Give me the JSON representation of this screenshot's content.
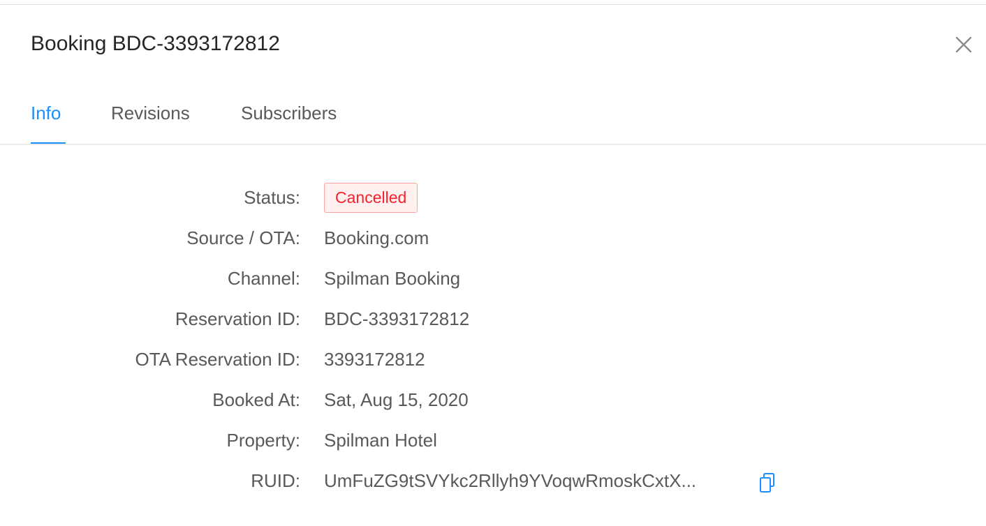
{
  "header": {
    "title": "Booking BDC-3393172812"
  },
  "tabs": [
    {
      "label": "Info",
      "active": true
    },
    {
      "label": "Revisions",
      "active": false
    },
    {
      "label": "Subscribers",
      "active": false
    }
  ],
  "info": {
    "status_label": "Status:",
    "status_value": "Cancelled",
    "source_label": "Source / OTA:",
    "source_value": "Booking.com",
    "channel_label": "Channel:",
    "channel_value": "Spilman Booking",
    "reservation_id_label": "Reservation ID:",
    "reservation_id_value": "BDC-3393172812",
    "ota_reservation_id_label": "OTA Reservation ID:",
    "ota_reservation_id_value": "3393172812",
    "booked_at_label": "Booked At:",
    "booked_at_value": "Sat, Aug 15, 2020",
    "property_label": "Property:",
    "property_value": "Spilman Hotel",
    "ruid_label": "RUID:",
    "ruid_value": "UmFuZG9tSVYkc2Rllyh9YVoqwRmoskCxtX..."
  },
  "icons": {
    "close": "close-icon",
    "copy": "copy-icon"
  },
  "colors": {
    "accent": "#1890ff",
    "status_cancelled_text": "#f5222d",
    "status_cancelled_bg": "#fff1f0",
    "status_cancelled_border": "#ffa39e"
  }
}
